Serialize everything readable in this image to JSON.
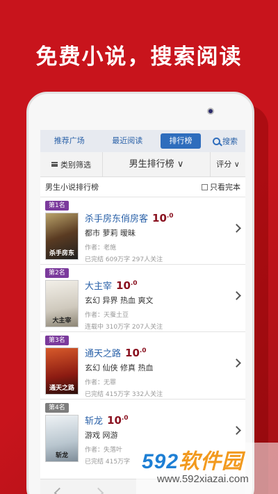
{
  "headline": "免费小说，搜索阅读",
  "nav": {
    "tabs": [
      "推荐广场",
      "最近阅读",
      "排行榜"
    ],
    "active_index": 2,
    "search_label": "搜索"
  },
  "filters": {
    "category": "类别筛选",
    "ranking": "男生排行榜",
    "sort": "评分"
  },
  "list_header": {
    "title": "男生小说排行榜",
    "checkbox_label": "只看完本"
  },
  "books": [
    {
      "rank": "第1名",
      "title": "杀手房东俏房客",
      "score": "10",
      "score_dec": ".0",
      "tags": "都市 萝莉 暧昧",
      "author": "作者：老施",
      "stats": "已完结 609万字 297人关注",
      "cover_text": "杀手房东"
    },
    {
      "rank": "第2名",
      "title": "大主宰",
      "score": "10",
      "score_dec": ".0",
      "tags": "玄幻 异界 热血 爽文",
      "author": "作者：天蚕土豆",
      "stats": "连载中 310万字 207人关注",
      "cover_text": "大主宰"
    },
    {
      "rank": "第3名",
      "title": "通天之路",
      "score": "10",
      "score_dec": ".0",
      "tags": "玄幻 仙侠 修真 热血",
      "author": "作者：无罪",
      "stats": "已完结 415万字 332人关注",
      "cover_text": "通天之路"
    },
    {
      "rank": "第4名",
      "title": "斩龙",
      "score": "10",
      "score_dec": ".0",
      "tags": "游戏 网游",
      "author": "作者：失落叶",
      "stats": "已完结 415万字",
      "cover_text": "斩龙"
    }
  ],
  "watermark": {
    "logo_num": "592",
    "logo_text": "软件园",
    "url": "www.592xiazai.com"
  },
  "colors": {
    "background": "#c8141c",
    "accent_blue": "#2e6dbd",
    "score_red": "#8a1220",
    "rank_purple": "#7b3a9c"
  }
}
